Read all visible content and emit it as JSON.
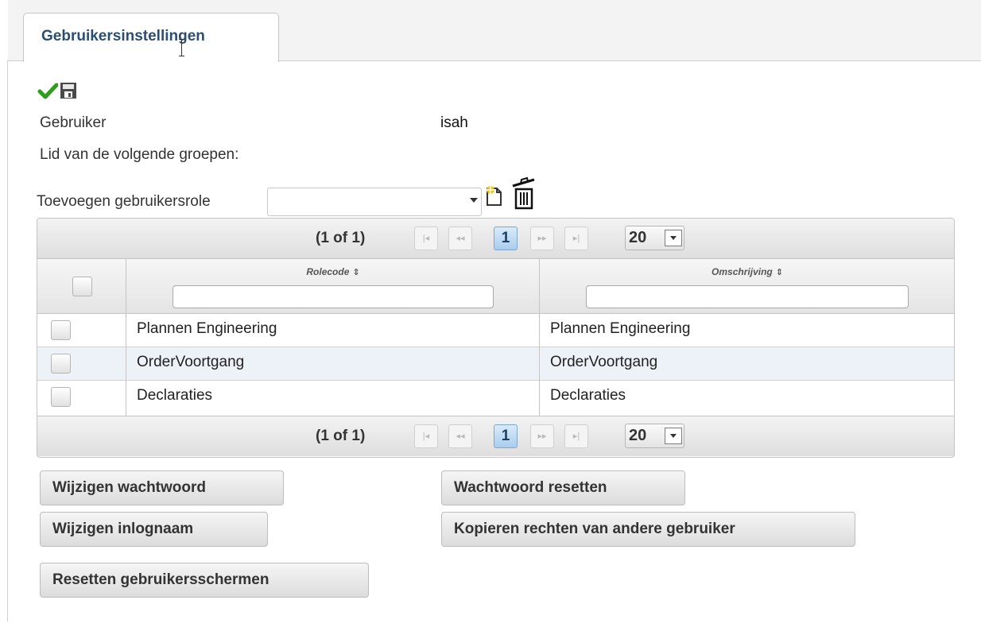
{
  "tabs": [
    {
      "label": "Gebruikersinstellingen",
      "active": true
    }
  ],
  "toolbar": {
    "confirm_icon": "check-icon",
    "save_icon": "floppy-disk-icon"
  },
  "user": {
    "label": "Gebruiker",
    "value": "isah"
  },
  "groups_label": "Lid van de volgende groepen:",
  "add_role": {
    "label": "Toevoegen gebruikersrole",
    "selected_value": "",
    "new_icon": "new-document-icon",
    "delete_icon": "trash-icon"
  },
  "paginator": {
    "info": "(1 of 1)",
    "current_page": "1",
    "rows_per_page": "20",
    "first": "|◂",
    "prev": "◂◂",
    "next": "▸▸",
    "last": "▸|"
  },
  "table": {
    "columns": [
      {
        "header": "Rolecode",
        "filter_value": ""
      },
      {
        "header": "Omschrijving",
        "filter_value": ""
      }
    ],
    "sort_icon": "⇕",
    "rows": [
      {
        "rolecode": "Plannen Engineering",
        "omschrijving": "Plannen Engineering"
      },
      {
        "rolecode": "OrderVoortgang",
        "omschrijving": "OrderVoortgang"
      },
      {
        "rolecode": "Declaraties",
        "omschrijving": "Declaraties"
      }
    ]
  },
  "buttons": {
    "change_password": "Wijzigen wachtwoord",
    "reset_password": "Wachtwoord resetten",
    "change_login": "Wijzigen inlognaam",
    "copy_rights": "Kopieren rechten van andere gebruiker",
    "reset_screens": "Resetten gebruikersschermen"
  },
  "colors": {
    "tab_text": "#2a4f73",
    "active_page": "#a9cdee",
    "alt_row": "#edf2f8",
    "check_green": "#2e9e1a"
  }
}
